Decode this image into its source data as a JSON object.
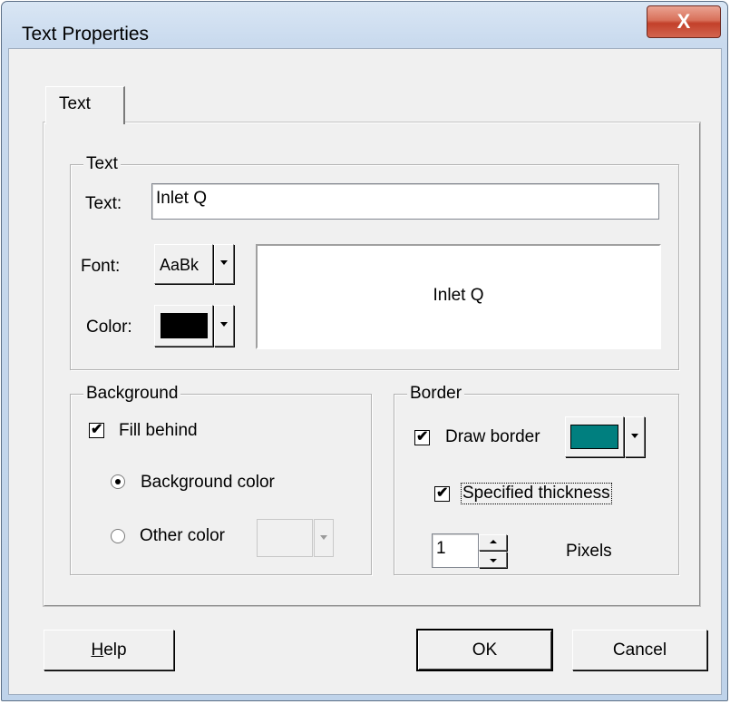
{
  "window": {
    "title": "Text Properties",
    "close_glyph": "X"
  },
  "tabs": [
    {
      "label": "Text",
      "active": true
    }
  ],
  "text_group": {
    "legend": "Text",
    "text_label": "Text:",
    "text_value": "Inlet Q",
    "font_label": "Font:",
    "font_sample": "AaBk",
    "color_label": "Color:",
    "text_color": "#000000",
    "preview_text": "Inlet Q"
  },
  "background_group": {
    "legend": "Background",
    "fill_behind_label": "Fill behind",
    "fill_behind_checked": true,
    "background_color_label": "Background color",
    "other_color_label": "Other color",
    "selected_option": "background_color"
  },
  "border_group": {
    "legend": "Border",
    "draw_border_label": "Draw border",
    "draw_border_checked": true,
    "border_color": "#007f7f",
    "specified_thickness_label": "Specified thickness",
    "specified_thickness_checked": true,
    "thickness_value": "1",
    "pixels_label": "Pixels"
  },
  "buttons": {
    "help": "Help",
    "help_mnemonic": "H",
    "help_rest": "elp",
    "ok": "OK",
    "cancel": "Cancel"
  },
  "icons": {
    "close": "close-icon",
    "dropdown": "chevron-down-icon",
    "spin_up": "spin-up-icon",
    "spin_down": "spin-down-icon",
    "check": "checkmark-icon"
  }
}
